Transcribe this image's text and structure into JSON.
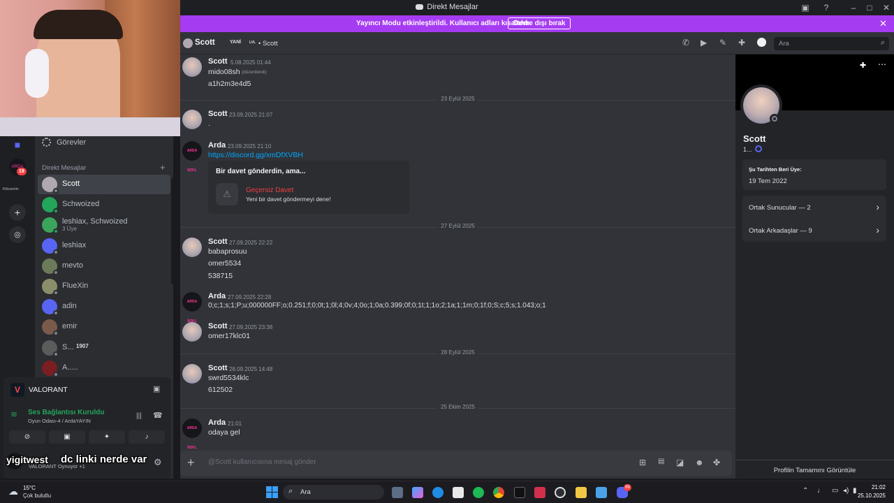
{
  "window": {
    "title": "Direkt Mesajlar"
  },
  "banner": {
    "text": "Yayıncı Modu etkinleştirildi. Kullanıcı adları kısaltıldı.",
    "button": "Devre dışı bırak"
  },
  "header": {
    "name": "Scott",
    "tag1": "YANİ",
    "tag2": "LVL",
    "sub": "• Scott",
    "search_placeholder": "Ara"
  },
  "rail": {
    "badge": "19",
    "label": "Kilicsemin"
  },
  "sidebar": {
    "tasks": "Görevler",
    "dm_header": "Direkt Mesajlar",
    "add": "+",
    "items": [
      {
        "name": "Scott",
        "sub": "",
        "online": false
      },
      {
        "name": "Schwoized",
        "sub": "",
        "online": true
      },
      {
        "name": "leshiax, Schwoized",
        "sub": "3 Üye",
        "online": true
      },
      {
        "name": "leshiax",
        "sub": "",
        "online": false
      },
      {
        "name": "mevto",
        "sub": "",
        "online": false
      },
      {
        "name": "FlueXin",
        "sub": "",
        "online": false
      },
      {
        "name": "adin",
        "sub": "",
        "online": false
      },
      {
        "name": "emir",
        "sub": "",
        "online": false
      },
      {
        "name": "S...",
        "sub": "",
        "online": false,
        "badge": "1907"
      },
      {
        "name": "A.....",
        "sub": "",
        "online": false
      }
    ]
  },
  "voice": {
    "game": "VALORANT",
    "status": "Ses Bağlantısı Kuruldu",
    "channel": "Oyun Odası-4 / ArdaYAYIN",
    "user_sub": "VALORANT Oynuyor +1"
  },
  "overlay": {
    "name": "yigitwest",
    "text": "dc linki nerde var"
  },
  "messages": {
    "m1": {
      "author": "Scott",
      "time": "5.08.2025 01:44",
      "line1": "mido08sh",
      "edited": "(düzenlendi)",
      "line2": "a1h2m3e4d5"
    },
    "sep1": "23 Eylül 2025",
    "m2": {
      "author": "Scott",
      "time": "23.09.2025 21:07",
      "line1": "."
    },
    "m3": {
      "author": "Arda",
      "time": "23.09.2025 21:10",
      "link": "https://discord.gg/xmDfXVBH",
      "invite_title": "Bir davet gönderdin, ama...",
      "invite_invalid": "Geçersiz Davet",
      "invite_sub": "Yeni bir davet göndermeyi dene!"
    },
    "sep2": "27 Eylül 2025",
    "m4": {
      "author": "Scott",
      "time": "27.09.2025 22:22",
      "line1": "babaprosuu",
      "line2": "omer5534",
      "line3": "538715"
    },
    "m5": {
      "author": "Arda",
      "time": "27.09.2025 22:28",
      "line1": "0;c;1;s;1;P;u;000000FF;o;0.251;f;0;0t;1;0l;4;0v;4;0o;1;0a;0.399;0f;0;1t;1;1o;2;1a;1;1m;0;1f;0;S;c;5;s;1.043;o;1"
    },
    "m6": {
      "author": "Scott",
      "time": "27.09.2025 23:38",
      "line1": "omer17klc01"
    },
    "sep3": "28 Eylül 2025",
    "m7": {
      "author": "Scott",
      "time": "28.09.2025 14:48",
      "line1": "swrd5534klc",
      "line2": "612502"
    },
    "sep4": "25 Ekim 2025",
    "m8": {
      "author": "Arda",
      "time": "21:01",
      "line1": "odaya gel"
    }
  },
  "arda_avatar_text": "ARDA BZKL",
  "composer": {
    "placeholder": "@Scott kullanıcısına mesaj gönder"
  },
  "profile": {
    "name": "Scott",
    "sub": "1...",
    "member_since_label": "Şu Tarihten Beri Üye:",
    "member_since": "19 Tem 2022",
    "mutual_servers": "Ortak Sunucular — 2",
    "mutual_friends": "Ortak Arkadaşlar — 9",
    "view_full": "Profilin Tamamını Görüntüle"
  },
  "taskbar": {
    "weather_temp": "15°C",
    "weather_desc": "Çok bulutlu",
    "search": "Ara",
    "time": "21:02",
    "date": "25.10.2025",
    "discord_badge": "99"
  },
  "colors": {
    "accent": "#5865f2",
    "banner": "#a63cf2",
    "online": "#23a55a",
    "link": "#00a8fc",
    "invalid": "#f23f43"
  }
}
